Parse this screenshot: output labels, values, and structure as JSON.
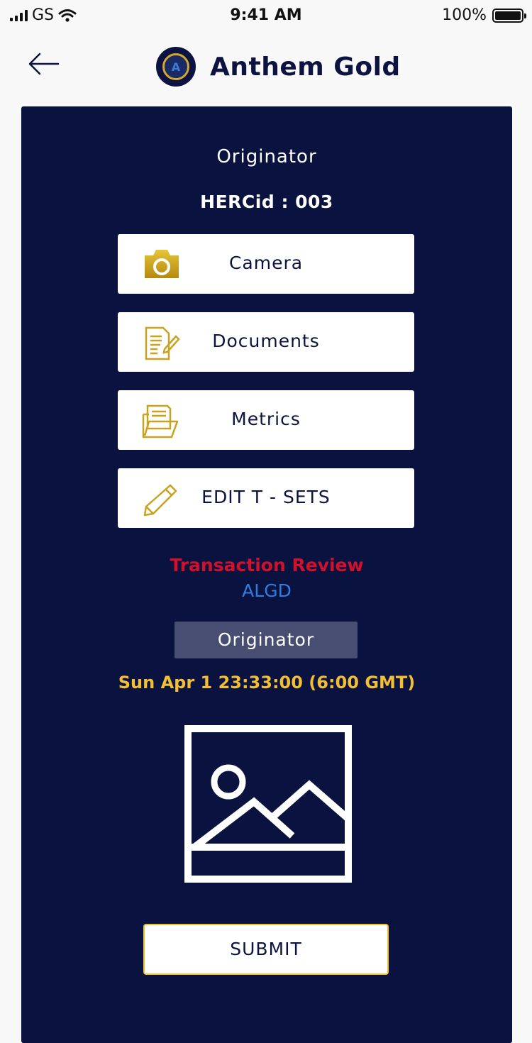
{
  "status_bar": {
    "carrier": "GS",
    "time": "9:41 AM",
    "battery": "100%"
  },
  "header": {
    "title": "Anthem Gold",
    "logo_letter": "A"
  },
  "card": {
    "role": "Originator",
    "herc_id": "HERCid : 003",
    "menu": [
      {
        "label": "Camera",
        "icon": "camera-icon"
      },
      {
        "label": "Documents",
        "icon": "document-edit-icon"
      },
      {
        "label": "Metrics",
        "icon": "folder-icon"
      },
      {
        "label": "EDIT T - SETS",
        "icon": "pencil-icon"
      }
    ],
    "transaction_title": "Transaction Review",
    "transaction_code": "ALGD",
    "tag": "Originator",
    "datetime": "Sun Apr 1 23:33:00 (6:00 GMT)",
    "image_icon": "image-placeholder-icon",
    "submit_label": "SUBMIT"
  },
  "colors": {
    "navy": "#0a1240",
    "gold": "#f2be35",
    "red": "#d0112b",
    "blue": "#2f7de1",
    "tag_bg": "#474e72"
  }
}
